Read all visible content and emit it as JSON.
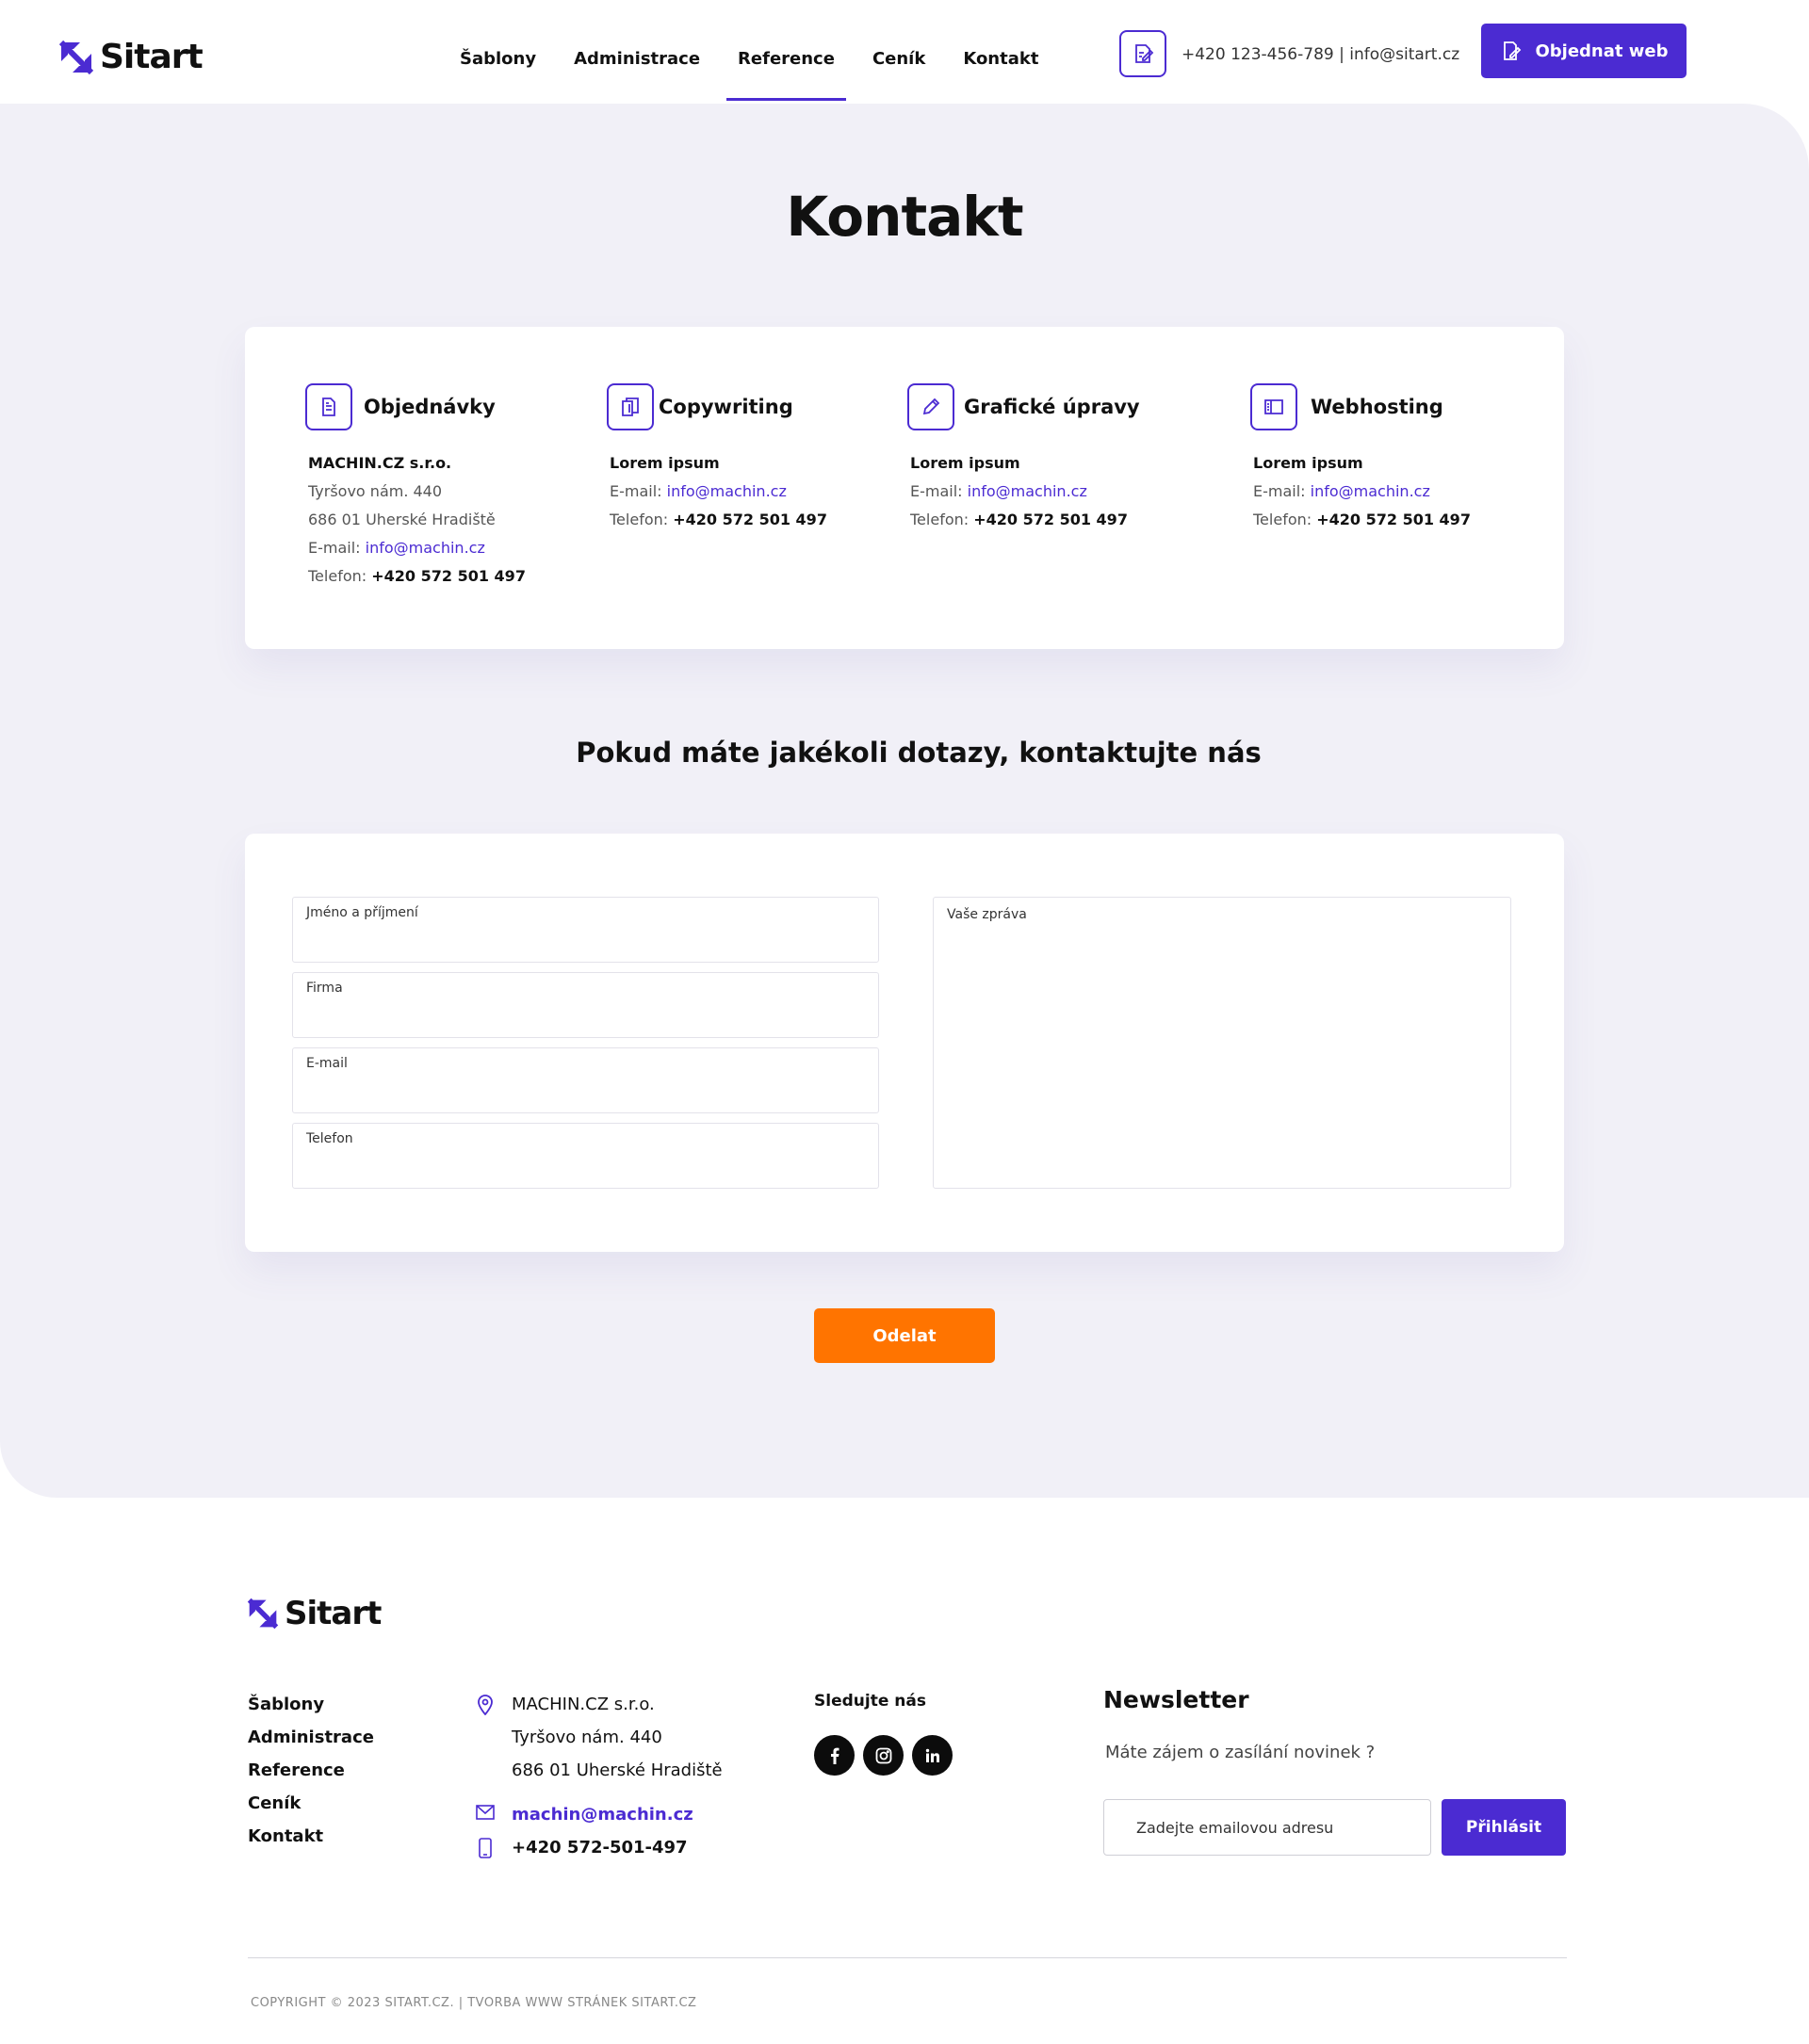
{
  "brand": {
    "name": "Sitart",
    "accent": "#4b2bd2",
    "cta_color": "#ff7400"
  },
  "nav": [
    {
      "label": "Šablony",
      "active": false
    },
    {
      "label": "Administrace",
      "active": false
    },
    {
      "label": "Reference",
      "active": true
    },
    {
      "label": "Ceník",
      "active": false
    },
    {
      "label": "Kontakt",
      "active": false
    }
  ],
  "header": {
    "contact_icon": "edit-document-icon",
    "contact_text": "+420 123-456-789  |  info@sitart.cz",
    "order_button": "Objednat web"
  },
  "page": {
    "title": "Kontakt",
    "subtitle": "Pokud máte jakékoli dotazy, kontaktujte nás"
  },
  "departments": [
    {
      "icon": "document-icon",
      "title": "Objednávky",
      "name": "MACHIN.CZ s.r.o.",
      "address1": "Tyršovo nám. 440",
      "address2": "686 01 Uherské Hradiště",
      "email_label": "E-mail: ",
      "email": "info@machin.cz",
      "phone_label": "Telefon: ",
      "phone": "+420 572 501 497"
    },
    {
      "icon": "copy-document-icon",
      "title": "Copywriting",
      "name": "Lorem ipsum",
      "email_label": "E-mail: ",
      "email": "info@machin.cz",
      "phone_label": "Telefon: ",
      "phone": "+420 572 501 497"
    },
    {
      "icon": "pencil-icon",
      "title": "Grafické úpravy",
      "name": "Lorem ipsum",
      "email_label": "E-mail: ",
      "email": "info@machin.cz",
      "phone_label": "Telefon: ",
      "phone": "+420 572 501 497"
    },
    {
      "icon": "server-icon",
      "title": "Webhosting",
      "name": "Lorem ipsum",
      "email_label": "E-mail: ",
      "email": "info@machin.cz",
      "phone_label": "Telefon: ",
      "phone": "+420 572 501 497"
    }
  ],
  "form": {
    "name_label": "Jméno a příjmení",
    "company_label": "Firma",
    "email_label": "E-mail",
    "phone_label": "Telefon",
    "message_label": "Vaše zpráva",
    "submit": "Odelat"
  },
  "footer": {
    "nav": [
      "Šablony",
      "Administrace",
      "Reference",
      "Ceník",
      "Kontakt"
    ],
    "company": "MACHIN.CZ s.r.o.",
    "address1": "Tyršovo nám. 440",
    "address2": "686 01 Uherské Hradiště",
    "email": "machin@machin.cz",
    "phone": "+420 572-501-497",
    "follow_label": "Sledujte nás",
    "socials": [
      "facebook-icon",
      "instagram-icon",
      "linkedin-icon"
    ],
    "newsletter_title": "Newsletter",
    "newsletter_text": "Máte zájem o zasílání novinek ?",
    "newsletter_placeholder": "Zadejte emailovou adresu",
    "newsletter_button": "Přihlásit",
    "copyright": "COPYRIGHT © 2023 SITART.CZ. |  TVORBA WWW STRÁNEK SITART.CZ"
  }
}
